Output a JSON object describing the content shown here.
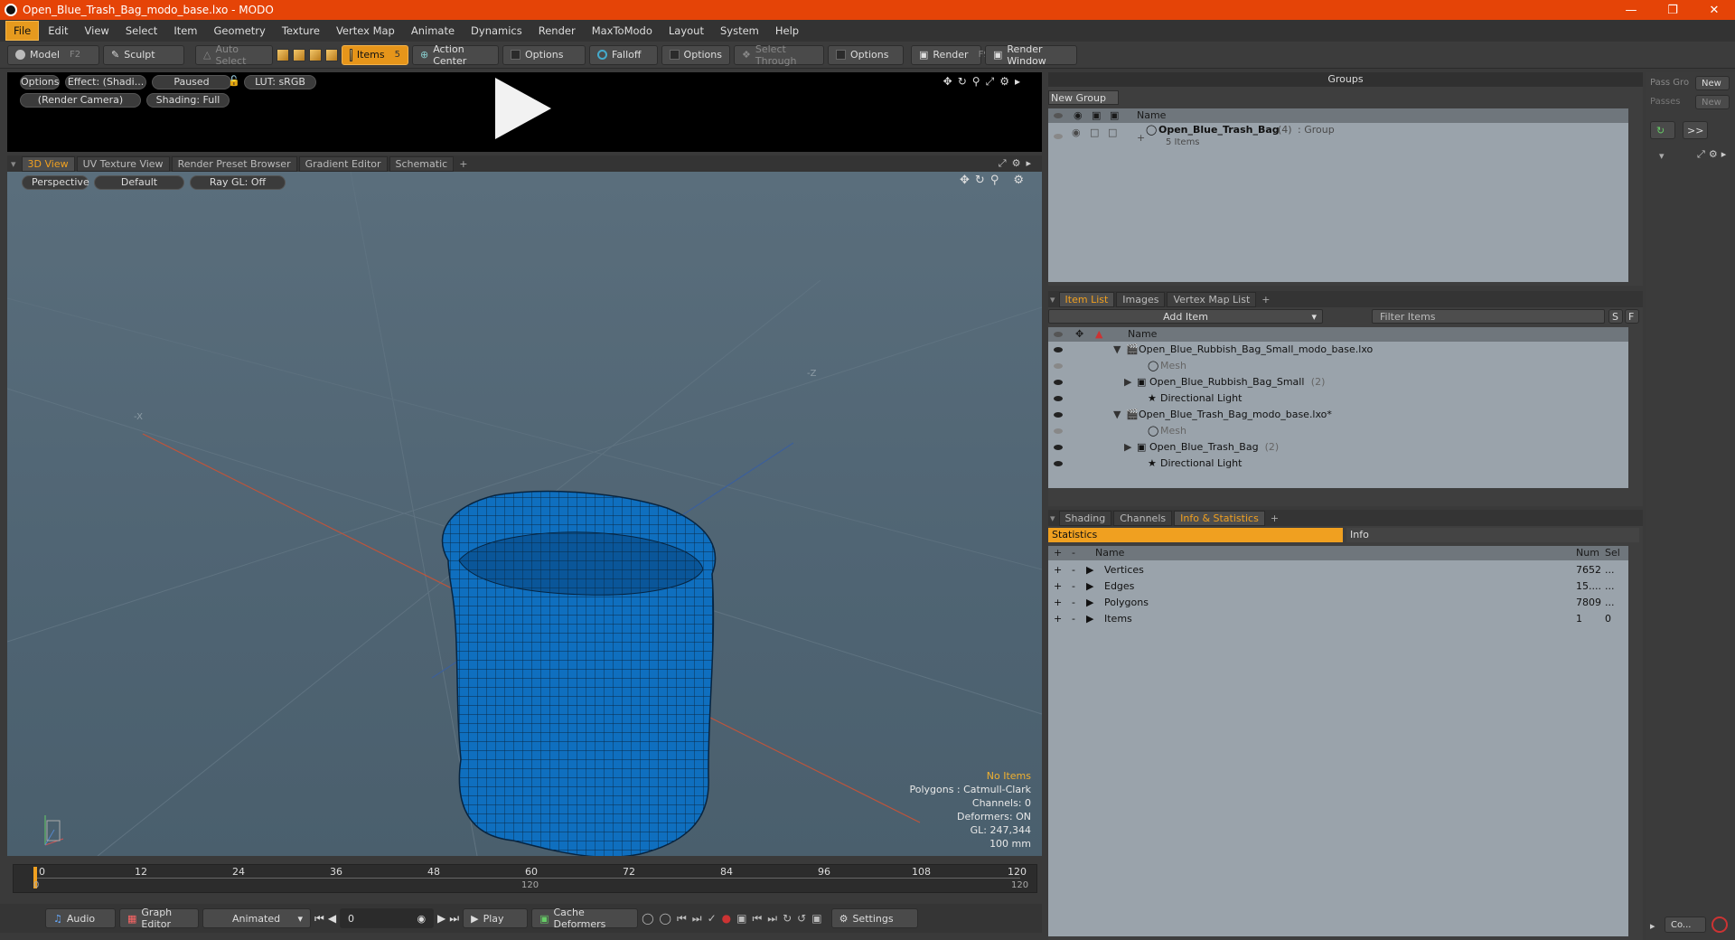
{
  "window": {
    "title": "Open_Blue_Trash_Bag_modo_base.lxo - MODO"
  },
  "menu": [
    "File",
    "Edit",
    "View",
    "Select",
    "Item",
    "Geometry",
    "Texture",
    "Vertex Map",
    "Animate",
    "Dynamics",
    "Render",
    "MaxToModo",
    "Layout",
    "System",
    "Help"
  ],
  "toolbar": {
    "model": "Model",
    "model_key": "F2",
    "sculpt": "Sculpt",
    "auto_select": "Auto Select",
    "items": "Items",
    "items_key": "5",
    "action_center": "Action Center",
    "options1": "Options",
    "falloff": "Falloff",
    "options2": "Options",
    "select_through": "Select Through",
    "options3": "Options",
    "render": "Render",
    "render_key": "F9",
    "render_window": "Render Window"
  },
  "render_preview": {
    "options": "Options",
    "effect": "Effect: (Shadi...",
    "paused": "Paused",
    "lut": "LUT: sRGB",
    "camera": "(Render Camera)",
    "shading": "Shading: Full"
  },
  "viewport_tabs": [
    "3D View",
    "UV Texture View",
    "Render Preset Browser",
    "Gradient Editor",
    "Schematic",
    "+"
  ],
  "viewport": {
    "perspective": "Perspective",
    "default": "Default",
    "raygl": "Ray GL: Off",
    "axis_x": "-X",
    "axis_z": "-Z",
    "hud": [
      "Polygons : Catmull-Clark",
      "Channels: 0",
      "Deformers: ON",
      "GL: 247,344",
      "100 mm"
    ],
    "hud_warn": "No Items"
  },
  "timeline": {
    "ticks": [
      "0",
      "12",
      "24",
      "36",
      "48",
      "60",
      "72",
      "84",
      "96",
      "108",
      "120"
    ],
    "sub_left": "0",
    "sub_mid": "120",
    "sub_right": "120"
  },
  "bottom": {
    "audio": "Audio",
    "graph_editor": "Graph Editor",
    "animated": "Animated",
    "frame": "0",
    "play": "Play",
    "cache": "Cache Deformers",
    "settings": "Settings"
  },
  "groups": {
    "title": "Groups",
    "new_group": "New Group",
    "col_name": "Name",
    "item_name": "Open_Blue_Trash_Bag",
    "item_count": "(4)",
    "item_type": ": Group",
    "item_sub": "5 Items"
  },
  "pass": {
    "pass_group": "Pass Gro",
    "new1": "New",
    "passes": "Passes",
    "new2": "New",
    "more": ">>"
  },
  "item_list": {
    "tabs": [
      "Item List",
      "Images",
      "Vertex Map List",
      "+"
    ],
    "add_item": "Add Item",
    "filter": "Filter Items",
    "s": "S",
    "f": "F",
    "col_name": "Name",
    "rows": [
      {
        "label": "Open_Blue_Rubbish_Bag_Small_modo_base.lxo",
        "indent": 0,
        "kind": "scene",
        "dim": false
      },
      {
        "label": "Mesh",
        "indent": 2,
        "kind": "mesh",
        "dim": true
      },
      {
        "label": "Open_Blue_Rubbish_Bag_Small",
        "count": "(2)",
        "indent": 1,
        "kind": "group",
        "dim": false
      },
      {
        "label": "Directional Light",
        "indent": 2,
        "kind": "light",
        "dim": false
      },
      {
        "label": "Open_Blue_Trash_Bag_modo_base.lxo*",
        "indent": 0,
        "kind": "scene",
        "dim": false
      },
      {
        "label": "Mesh",
        "indent": 2,
        "kind": "mesh",
        "dim": true
      },
      {
        "label": "Open_Blue_Trash_Bag",
        "count": "(2)",
        "indent": 1,
        "kind": "group",
        "dim": false
      },
      {
        "label": "Directional Light",
        "indent": 2,
        "kind": "light",
        "dim": false
      }
    ]
  },
  "stats": {
    "tabs": [
      "Shading",
      "Channels",
      "Info & Statistics",
      "+"
    ],
    "statistics": "Statistics",
    "info": "Info",
    "col_name": "Name",
    "col_num": "Num",
    "col_sel": "Sel",
    "rows": [
      {
        "name": "Vertices",
        "num": "7652",
        "sel": "..."
      },
      {
        "name": "Edges",
        "num": "15....",
        "sel": "..."
      },
      {
        "name": "Polygons",
        "num": "7809",
        "sel": "..."
      },
      {
        "name": "Items",
        "num": "1",
        "sel": "0"
      }
    ]
  },
  "corner": {
    "co": "Co..."
  }
}
